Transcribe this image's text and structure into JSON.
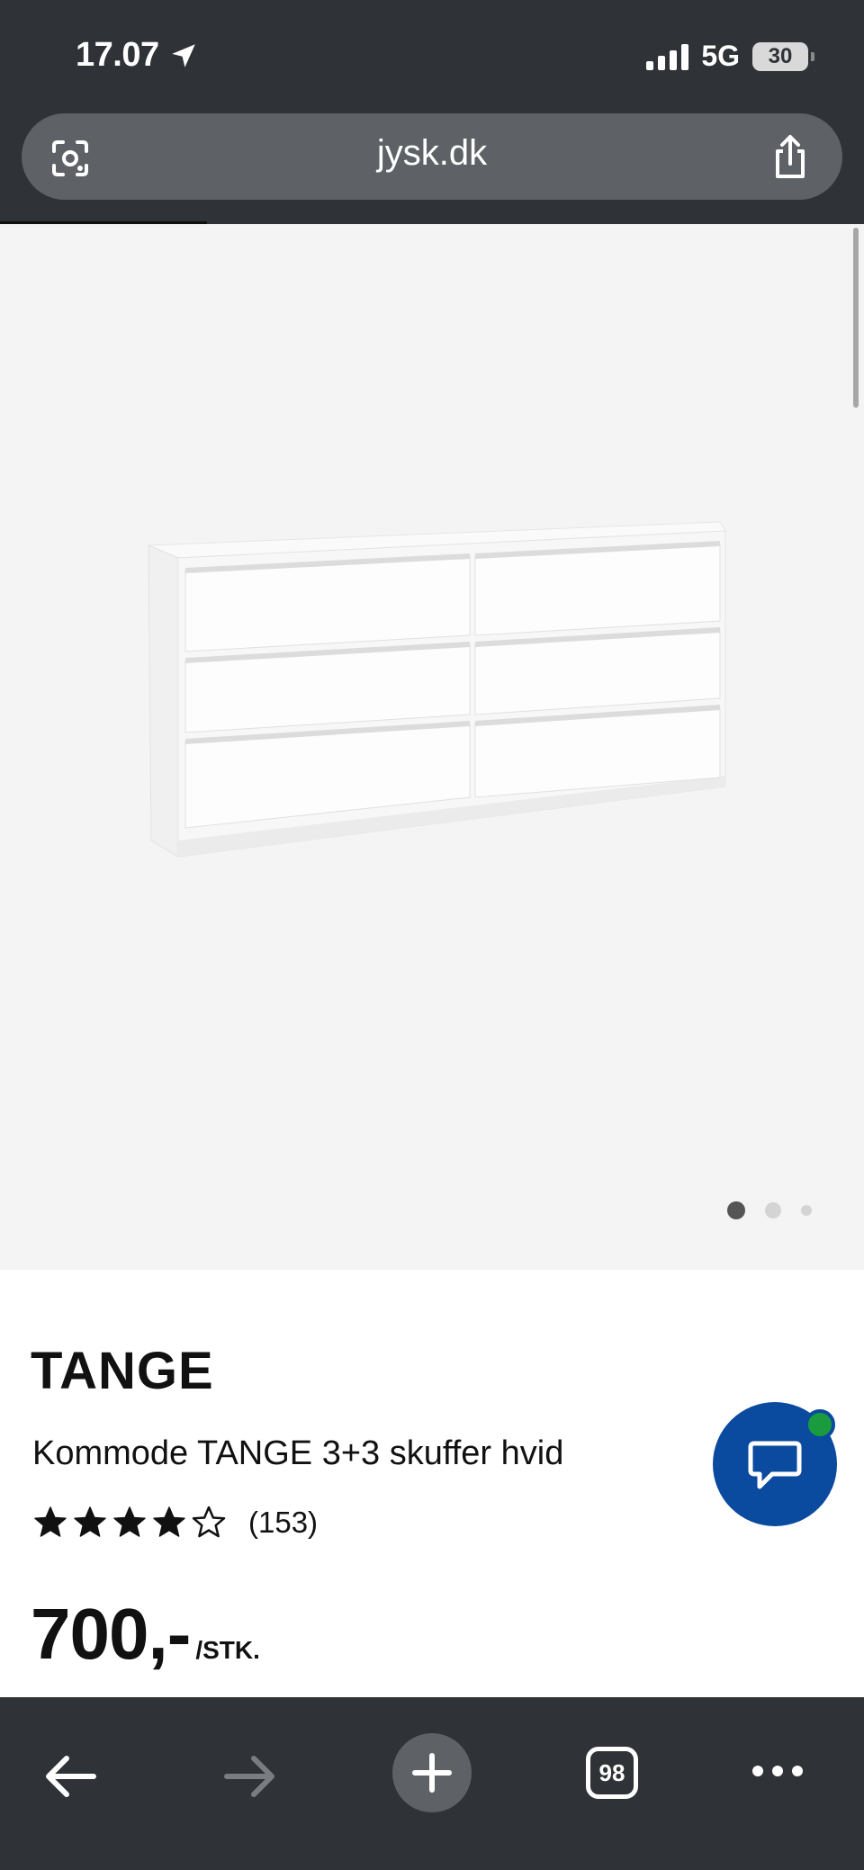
{
  "status_bar": {
    "time": "17.07",
    "network": "5G",
    "battery": "30"
  },
  "browser": {
    "url": "jysk.dk",
    "tabs_count": "98"
  },
  "product": {
    "brand": "TANGE",
    "title": "Kommode TANGE 3+3 skuffer hvid",
    "rating_value": 4,
    "rating_max": 5,
    "reviews_count": "(153)",
    "price": "700,-",
    "price_unit": "/STK."
  },
  "gallery": {
    "slides_total": 3,
    "active_slide": 1
  },
  "colors": {
    "chat_button": "#0a4a9f",
    "online_indicator": "#1a9c3e",
    "browser_chrome": "#2f3236"
  }
}
